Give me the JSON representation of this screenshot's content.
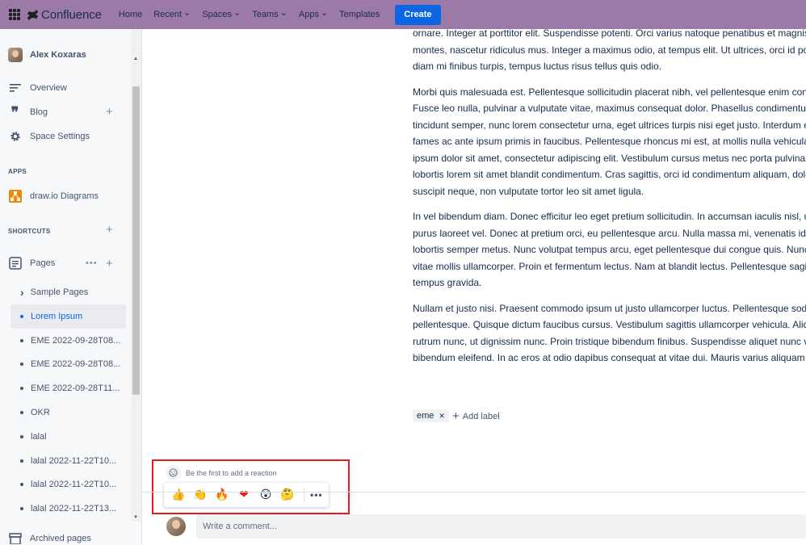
{
  "topnav": {
    "logo_text": "Confluence",
    "items": [
      {
        "label": "Home",
        "has_menu": false
      },
      {
        "label": "Recent",
        "has_menu": true
      },
      {
        "label": "Spaces",
        "has_menu": true
      },
      {
        "label": "Teams",
        "has_menu": true
      },
      {
        "label": "Apps",
        "has_menu": true
      },
      {
        "label": "Templates",
        "has_menu": false
      }
    ],
    "create_label": "Create",
    "colors": {
      "bar": "#9c7aa8",
      "create": "#0c66e4"
    }
  },
  "sidebar": {
    "user_name": "Alex Koxaras",
    "nav": [
      {
        "label": "Overview",
        "icon": "overview-icon"
      },
      {
        "label": "Blog",
        "icon": "quote-icon"
      },
      {
        "label": "Space Settings",
        "icon": "gear-icon"
      }
    ],
    "apps_heading": "APPS",
    "apps": [
      {
        "label": "draw.io Diagrams",
        "icon": "drawio-icon"
      }
    ],
    "shortcuts_heading": "SHORTCUTS",
    "pages_label": "Pages",
    "tree": [
      {
        "label": "Sample Pages",
        "type": "caret"
      },
      {
        "label": "Lorem Ipsum",
        "type": "bullet",
        "active": true
      },
      {
        "label": "EME 2022-09-28T08...",
        "type": "bullet"
      },
      {
        "label": "EME 2022-09-28T08...",
        "type": "bullet"
      },
      {
        "label": "EME 2022-09-28T11...",
        "type": "bullet"
      },
      {
        "label": "OKR",
        "type": "bullet"
      },
      {
        "label": "lalal",
        "type": "bullet"
      },
      {
        "label": "lalal 2022-11-22T10...",
        "type": "bullet"
      },
      {
        "label": "lalal 2022-11-22T10...",
        "type": "bullet"
      },
      {
        "label": "lalal 2022-11-22T13...",
        "type": "bullet"
      }
    ],
    "archived_label": "Archived pages"
  },
  "content": {
    "paragraphs": [
      [
        "ornare. Integer at porttitor elit. Suspendisse potenti. Orci varius natoque penatibus et magnis dis parturient",
        "montes, nascetur ridiculus mus. Integer a maximus odio, at tempus elit. Ut ultrices, orci id porttitor",
        "diam mi finibus turpis, tempus luctus risus tellus quis odio."
      ],
      [
        "Morbi quis malesuada est. Pellentesque sollicitudin placerat nibh, vel pellentesque enim condimentum",
        "Fusce leo nulla, pulvinar a vulputate vitae, maximus consequat dolor. Phasellus condimentum, sapien",
        "tincidunt semper, nunc lorem consectetur urna, eget ultrices turpis nisi eget justo. Interdum et malesuada",
        "fames ac ante ipsum primis in faucibus. Pellentesque rhoncus mi est, at mollis nulla vehicula non. Lorem",
        "ipsum dolor sit amet, consectetur adipiscing elit. Vestibulum cursus metus nec porta pulvinar. Morbi",
        "lobortis lorem sit amet blandit condimentum. Cras sagittis, orci id condimentum aliquam, dolor nunc",
        "suscipit neque, non vulputate tortor leo sit amet ligula."
      ],
      [
        "In vel bibendum diam. Donec efficitur leo eget pretium sollicitudin. In accumsan iaculis nisl, ut tempor",
        "purus laoreet vel. Donec at pretium orci, eu pellentesque arcu. Nulla massa mi, venenatis id lacus eu,",
        "lobortis semper metus. Nunc volutpat tempus arcu, eget pellentesque dui congue quis. Nunc sed turpis",
        "vitae mollis ullamcorper. Proin et fermentum lectus. Nam at blandit lectus. Pellentesque sagittis lectus",
        "tempus gravida."
      ],
      [
        "Nullam et justo nisi. Praesent commodo ipsum ut justo ullamcorper luctus. Pellentesque sodales nibh",
        "pellentesque. Quisque dictum faucibus cursus. Vestibulum sagittis ullamcorper vehicula. Aliquam erat",
        "rutrum nunc, ut dignissim nunc. Proin tristique bibendum finibus. Suspendisse aliquet nunc vel lorem",
        "bibendum eleifend. In ac eros at odio dapibus consequat at vitae dui. Mauris varius aliquam orci"
      ]
    ],
    "label_chip": "eme",
    "add_label": "Add label"
  },
  "reactions": {
    "hint": "Be the first to add a reaction",
    "emojis": [
      {
        "name": "thumbs-up-icon",
        "glyph": "👍"
      },
      {
        "name": "clapping-hands-icon",
        "glyph": "👏"
      },
      {
        "name": "fire-icon",
        "glyph": "🔥"
      },
      {
        "name": "heart-icon",
        "glyph": "❤"
      },
      {
        "name": "astonished-face-icon",
        "glyph": "😲"
      },
      {
        "name": "thinking-face-icon",
        "glyph": "🤔"
      }
    ],
    "more": "•••",
    "highlight_color": "#e31b23"
  },
  "comment": {
    "placeholder": "Write a comment..."
  }
}
